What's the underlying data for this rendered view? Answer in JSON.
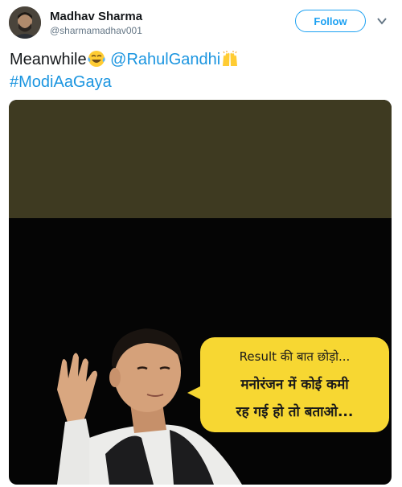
{
  "author": {
    "display_name": "Madhav Sharma",
    "handle": "@sharmamadhav001"
  },
  "actions": {
    "follow_label": "Follow"
  },
  "tweet": {
    "text_prefix": "Meanwhile",
    "emoji_1": "face-with-tears-of-joy",
    "mention": "@RahulGandhi",
    "emoji_2": "raising-hands",
    "hashtag": "#ModiAaGaya"
  },
  "media": {
    "bubble_line_1": "Result की बात छोड़ो...",
    "bubble_line_2": "मनोरंजन में कोई कमी",
    "bubble_line_3": "रह गई हो तो बताओ..."
  },
  "colors": {
    "link": "#1b95e0",
    "follow_border": "#1da1f2",
    "bubble": "#f7d732",
    "media_top": "#3e3a21"
  }
}
